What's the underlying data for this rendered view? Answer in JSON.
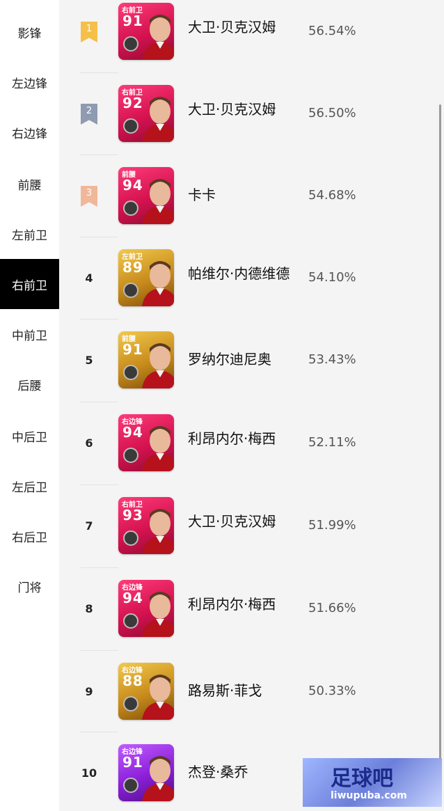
{
  "sidebar": {
    "items": [
      {
        "label": "影锋"
      },
      {
        "label": "左边锋"
      },
      {
        "label": "右边锋"
      },
      {
        "label": "前腰"
      },
      {
        "label": "左前卫"
      },
      {
        "label": "右前卫",
        "active": true
      },
      {
        "label": "中前卫"
      },
      {
        "label": "后腰"
      },
      {
        "label": "中后卫"
      },
      {
        "label": "左后卫"
      },
      {
        "label": "右后卫"
      },
      {
        "label": "门将"
      }
    ]
  },
  "rankings": [
    {
      "rank": "1",
      "medal": "gold",
      "position": "右前卫",
      "rating": "91",
      "name": "大卫·贝克汉姆",
      "percent": "56.54%",
      "card_color": "pink"
    },
    {
      "rank": "2",
      "medal": "silver",
      "position": "右前卫",
      "rating": "92",
      "name": "大卫·贝克汉姆",
      "percent": "56.50%",
      "card_color": "pink"
    },
    {
      "rank": "3",
      "medal": "bronze",
      "position": "前腰",
      "rating": "94",
      "name": "卡卡",
      "percent": "54.68%",
      "card_color": "pink"
    },
    {
      "rank": "4",
      "position": "左前卫",
      "rating": "89",
      "name": "帕维尔·内德维德",
      "percent": "54.10%",
      "card_color": "gold"
    },
    {
      "rank": "5",
      "position": "前腰",
      "rating": "91",
      "name": "罗纳尔迪尼奥",
      "percent": "53.43%",
      "card_color": "gold"
    },
    {
      "rank": "6",
      "position": "右边锋",
      "rating": "94",
      "name": "利昂内尔·梅西",
      "percent": "52.11%",
      "card_color": "pink"
    },
    {
      "rank": "7",
      "position": "右前卫",
      "rating": "93",
      "name": "大卫·贝克汉姆",
      "percent": "51.99%",
      "card_color": "pink"
    },
    {
      "rank": "8",
      "position": "右边锋",
      "rating": "94",
      "name": "利昂内尔·梅西",
      "percent": "51.66%",
      "card_color": "pink"
    },
    {
      "rank": "9",
      "position": "右边锋",
      "rating": "88",
      "name": "路易斯·菲戈",
      "percent": "50.33%",
      "card_color": "gold"
    },
    {
      "rank": "10",
      "position": "右边锋",
      "rating": "91",
      "name": "杰登·桑乔",
      "percent": "",
      "card_color": "purple"
    }
  ],
  "watermark": {
    "title": "足球吧",
    "url": "liwupuba.com"
  },
  "colors": {
    "gold_medal": "#f5c04a",
    "silver_medal": "#8e9bb0",
    "bronze_medal": "#f0b79a",
    "active_bg": "#000000"
  }
}
